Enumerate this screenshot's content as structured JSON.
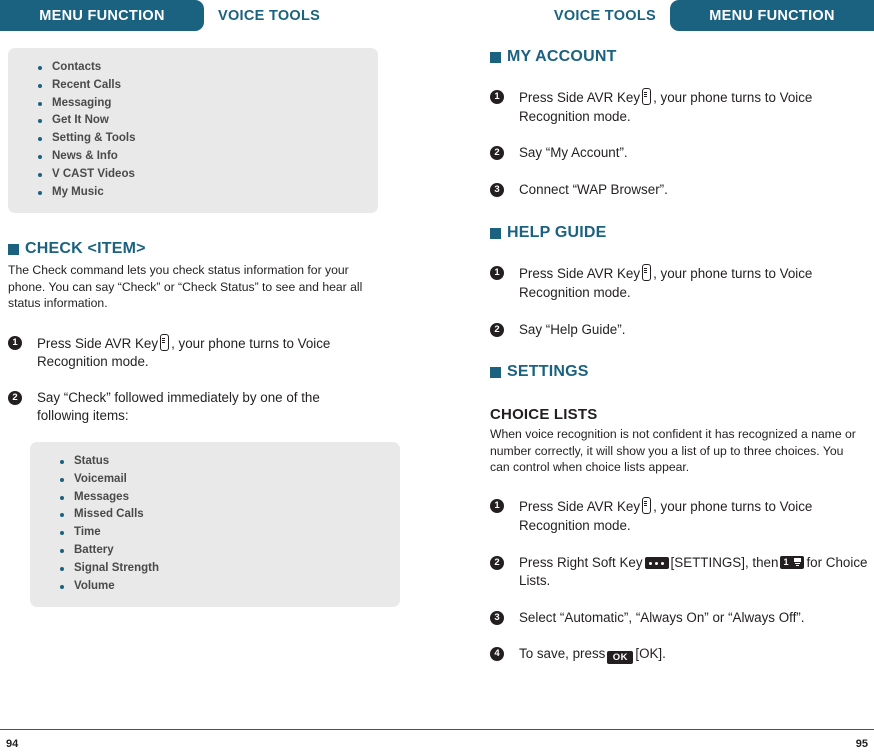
{
  "header": {
    "left_tab": "MENU FUNCTION",
    "left_label": "VOICE TOOLS",
    "right_label": "VOICE TOOLS",
    "right_tab": "MENU FUNCTION",
    "tab_color": "#1b6281"
  },
  "left_page": {
    "menu_list": [
      "Contacts",
      "Recent Calls",
      "Messaging",
      "Get It Now",
      "Setting & Tools",
      "News & Info",
      "V CAST Videos",
      "My Music"
    ],
    "check_section": {
      "heading": "CHECK <ITEM>",
      "body": "The Check command lets you check status information for your phone. You can say “Check” or “Check Status” to see and hear all status information.",
      "step1_before": "Press Side AVR Key",
      "step1_after": ", your phone turns to Voice Recognition mode.",
      "step1_num": "1",
      "step2_num": "2",
      "step2_text": "Say “Check” followed immediately by one of the following items:"
    },
    "check_items": [
      "Status",
      "Voicemail",
      "Messages",
      "Missed Calls",
      "Time",
      "Battery",
      "Signal Strength",
      "Volume"
    ],
    "page_number": "94"
  },
  "right_page": {
    "my_account": {
      "heading": "MY ACCOUNT",
      "step1_num": "1",
      "step1_before": "Press Side AVR Key",
      "step1_after": ", your phone turns to Voice Recognition mode.",
      "step2_num": "2",
      "step2_text": "Say “My Account”.",
      "step3_num": "3",
      "step3_text": "Connect “WAP Browser”."
    },
    "help_guide": {
      "heading": "HELP GUIDE",
      "step1_num": "1",
      "step1_before": "Press Side AVR Key",
      "step1_after": ", your phone turns to Voice Recognition mode.",
      "step2_num": "2",
      "step2_text": "Say “Help Guide”."
    },
    "settings": {
      "heading": "SETTINGS",
      "sub_heading": "CHOICE LISTS",
      "body": "When voice recognition is not confident it has recognized a name or number correctly, it will show you a list of up to three choices. You can control when choice lists appear.",
      "step1_num": "1",
      "step1_before": "Press Side AVR Key",
      "step1_after": ", your phone turns to Voice Recognition mode.",
      "step2_num": "2",
      "step2_before": "Press Right Soft Key",
      "step2_mid": "[SETTINGS], then",
      "step2_after": "for Choice Lists.",
      "step2_key_digit": "1",
      "step3_num": "3",
      "step3_text": "Select “Automatic”, “Always On” or “Always Off”.",
      "step4_num": "4",
      "step4_before": "To save, press",
      "step4_key": "OK",
      "step4_after": "[OK]."
    },
    "page_number": "95"
  }
}
